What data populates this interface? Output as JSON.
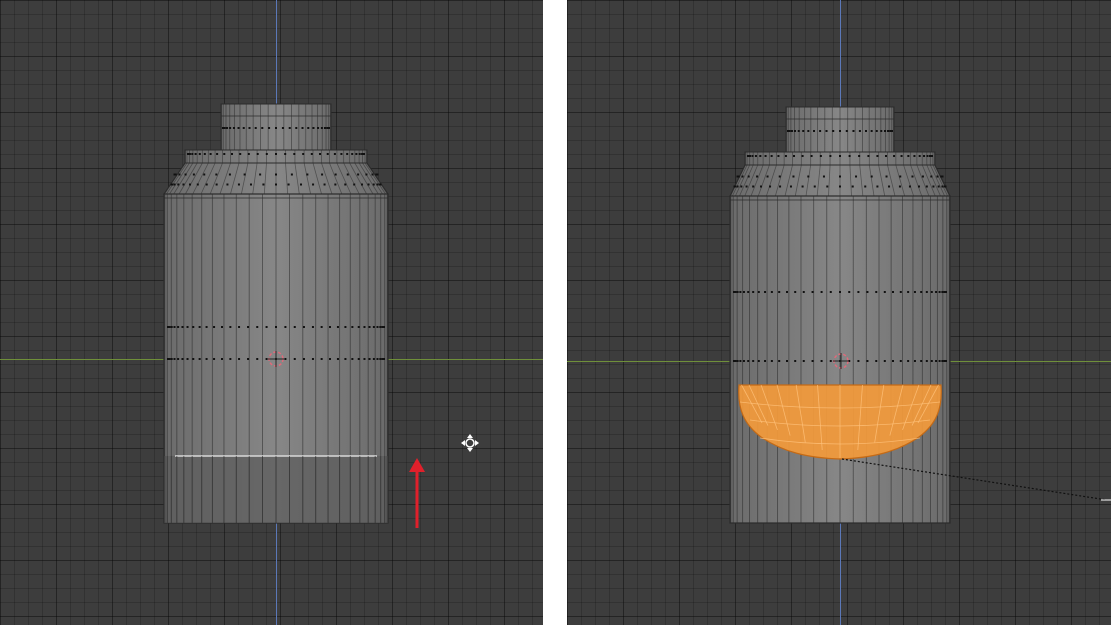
{
  "viewports": [
    {
      "id": "left",
      "mesh": "bottle",
      "selection": "none",
      "annotation": {
        "icon": "red-arrow-up-icon",
        "color": "#e0202b"
      },
      "cursor": "move-cursor-icon"
    },
    {
      "id": "right",
      "mesh": "bottle",
      "selection": "bottom-cap-faces",
      "selection_color": "#f39a3b",
      "cursor": "knife-line"
    }
  ],
  "colors": {
    "background": "#3d3d3d",
    "mesh_face": "#7a7a7a",
    "mesh_edge": "#2b2b2b",
    "axis_x": "#6f8f3a",
    "axis_y": "#5b78b8",
    "origin": "#e26a7a"
  }
}
